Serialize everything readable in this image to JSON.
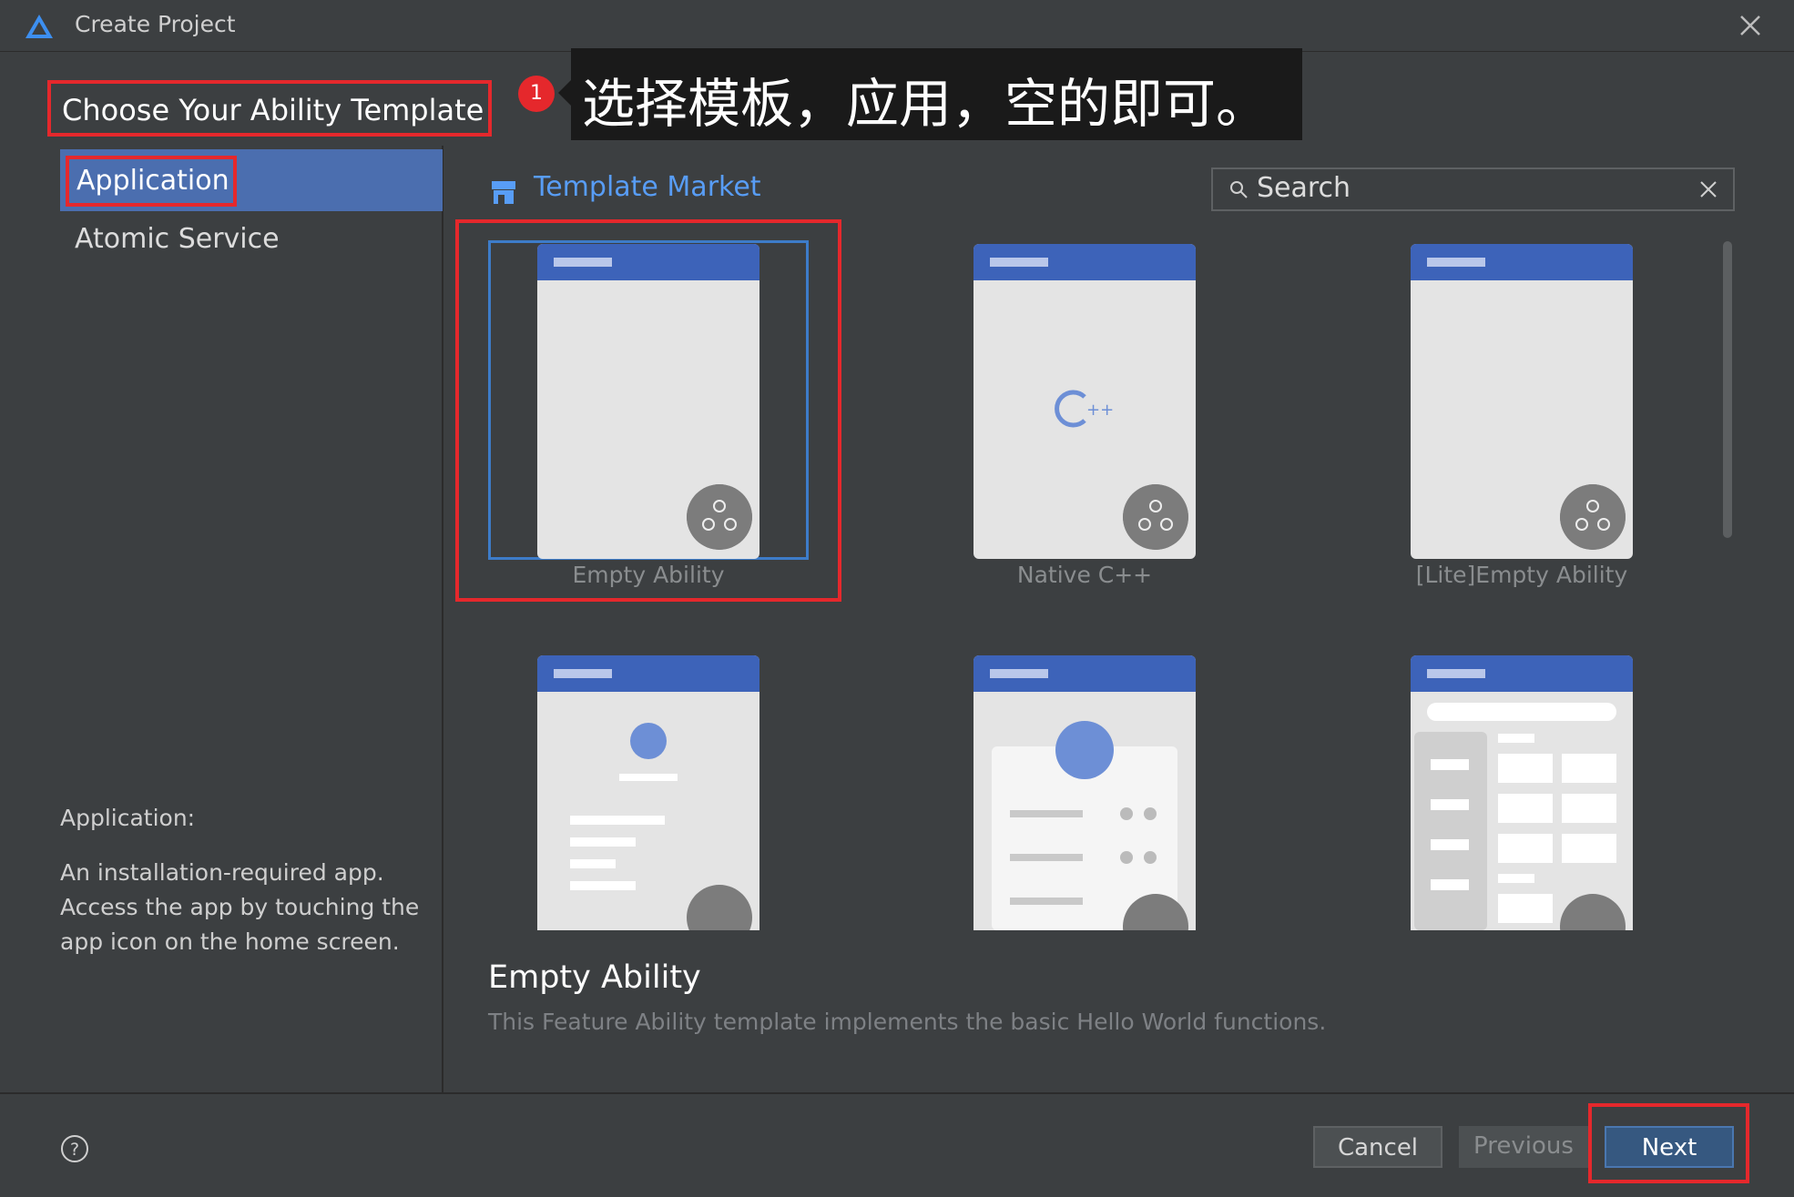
{
  "window": {
    "title": "Create Project"
  },
  "header": {
    "title": "Choose Your Ability Template"
  },
  "callout": {
    "number": "1",
    "text": "选择模板，应用，空的即可。"
  },
  "sidebar": {
    "items": [
      {
        "label": "Application",
        "selected": true
      },
      {
        "label": "Atomic Service",
        "selected": false
      }
    ],
    "description": {
      "heading": "Application:",
      "body": "An installation-required app. Access the app by touching the app icon on the home screen."
    }
  },
  "market": {
    "label": "Template Market"
  },
  "search": {
    "value": "Search"
  },
  "templates": [
    {
      "label": "Empty Ability",
      "selected": true
    },
    {
      "label": "Native C++",
      "selected": false
    },
    {
      "label": "[Lite]Empty Ability",
      "selected": false
    }
  ],
  "detail": {
    "title": "Empty Ability",
    "description": "This Feature Ability template implements the basic Hello World functions."
  },
  "footer": {
    "cancel": "Cancel",
    "previous": "Previous",
    "next": "Next"
  },
  "colors": {
    "accent": "#3d63b9",
    "highlight": "#e5282c",
    "link": "#589df6"
  }
}
